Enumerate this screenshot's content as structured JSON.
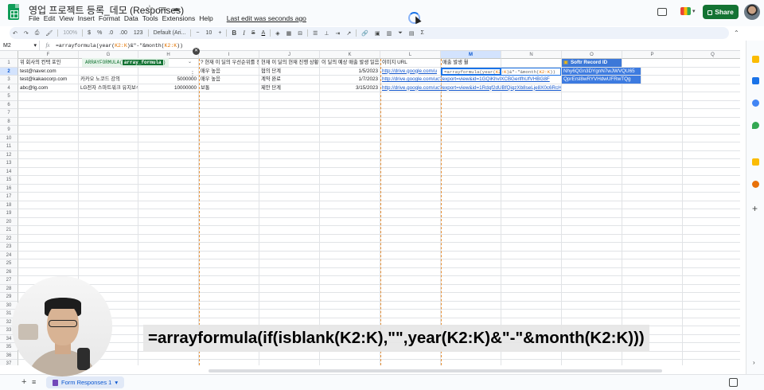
{
  "titlebar": {
    "doc_title": "영업 프로젝트 등록_데모 (Responses)",
    "menu": [
      "File",
      "Edit",
      "View",
      "Insert",
      "Format",
      "Data",
      "Tools",
      "Extensions",
      "Help"
    ],
    "last_edit": "Last edit was seconds ago",
    "share_label": "Share"
  },
  "toolbar": {
    "zoom": "100%",
    "currency": "$",
    "percent": "%",
    "dec_decrease": ".0",
    "dec_increase": ".00",
    "number_format": "123",
    "font": "Default (Ari...",
    "font_size": "10",
    "bold": "B",
    "italic": "I",
    "strike": "S",
    "text_color": "A",
    "sigma": "Σ"
  },
  "formula_bar": {
    "name_box": "M2",
    "fx": "fx",
    "formula_prefix": "=arrayformula(year(",
    "formula_ref1": "K2:K",
    "formula_mid": ")&\"-\"&month(",
    "formula_ref2": "K2:K",
    "formula_suffix": "))"
  },
  "columns": [
    "F",
    "G",
    "H",
    "I",
    "J",
    "K",
    "L",
    "M",
    "N",
    "O",
    "P",
    "Q"
  ],
  "rows": [
    "1",
    "2",
    "3",
    "4",
    "5",
    "6",
    "7",
    "8",
    "9",
    "10",
    "11",
    "12",
    "13",
    "14",
    "15",
    "16",
    "17",
    "18",
    "19",
    "20",
    "21",
    "22",
    "23",
    "24",
    "25",
    "26",
    "27",
    "28",
    "29",
    "30",
    "31",
    "32",
    "33",
    "34",
    "35",
    "36",
    "37"
  ],
  "header_row": {
    "F": "위 회사의 컨택 포인",
    "G": "ARRAYFORMULA(",
    "G_chip": "array_formula",
    "G_close": ")",
    "I": "? 현재 이 딜의 우선순위를 정하",
    "J": "현재 이 딜의 현재 진행 상황",
    "K": "이 딜의 예상 매출 발생 일음",
    "L": "이미지 URL",
    "M": "매출 발생 월",
    "O": "Softr Record ID"
  },
  "data_rows": [
    {
      "F": "test@naver.com",
      "G": "",
      "H": "",
      "I": "매우 높음",
      "J": "협의 단계",
      "K": "1/5/2023",
      "L": "http://drive.google.com/u",
      "O": "Nhy6QGn3DYgnN7wJWVQU65"
    },
    {
      "F": "test@kakaocorp.com",
      "G": "카카오 노코드 강의",
      "H": "5000000",
      "I": "매우 높음",
      "J": "계약 완료",
      "K": "1/7/2023",
      "L": "http://drive.google.com/uc?export=view&id=1GQiKhvlXCBGerlfhUfVHBG8F",
      "O": "QprErsl8wRYVHdwUFRwTQg"
    },
    {
      "F": "abc@lg.com",
      "G": "LG전자 스마트워크 유지보수",
      "H": "10000000",
      "I": "보통",
      "J": "제안 단계",
      "K": "3/15/2023",
      "L": "http://drive.google.com/uc?export=view&id=1Rdqf2dUBfQiqzXb8seLje8X0c6RcHpts",
      "O": ""
    }
  ],
  "inline_formula": {
    "prefix": "=arrayformula(year(",
    "ref1": "K2:K",
    "mid": ")&\"-\"&month(",
    "ref2": "K2:K",
    "suffix": "))"
  },
  "sheet_tab": {
    "label": "Form Responses 1"
  },
  "caption": "=arrayformula(if(isblank(K2:K),\"\",year(K2:K)&\"-\"&month(K2:K)))",
  "colors": {
    "share_green": "#137333",
    "selection_blue": "#1a73e8",
    "header_blue": "#3c78d8",
    "ref_orange": "#e37400"
  }
}
